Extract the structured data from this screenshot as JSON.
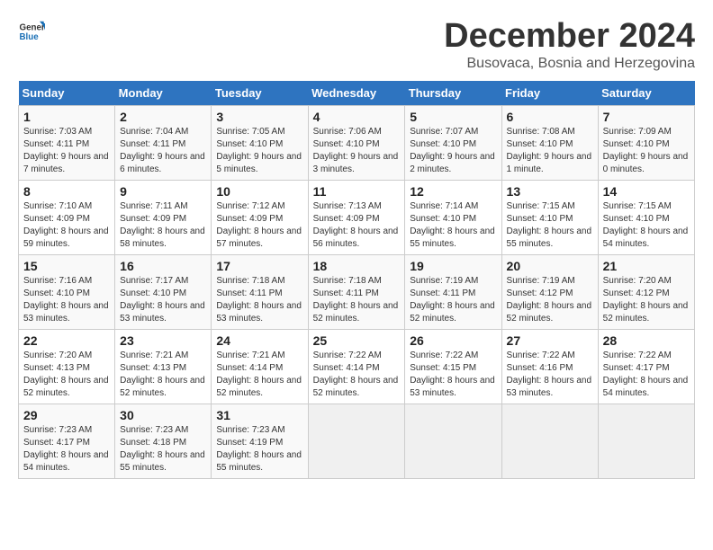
{
  "logo": {
    "text_general": "General",
    "text_blue": "Blue"
  },
  "title": "December 2024",
  "subtitle": "Busovaca, Bosnia and Herzegovina",
  "header": {
    "days": [
      "Sunday",
      "Monday",
      "Tuesday",
      "Wednesday",
      "Thursday",
      "Friday",
      "Saturday"
    ]
  },
  "weeks": [
    [
      {
        "day": "1",
        "sunrise": "Sunrise: 7:03 AM",
        "sunset": "Sunset: 4:11 PM",
        "daylight": "Daylight: 9 hours and 7 minutes."
      },
      {
        "day": "2",
        "sunrise": "Sunrise: 7:04 AM",
        "sunset": "Sunset: 4:11 PM",
        "daylight": "Daylight: 9 hours and 6 minutes."
      },
      {
        "day": "3",
        "sunrise": "Sunrise: 7:05 AM",
        "sunset": "Sunset: 4:10 PM",
        "daylight": "Daylight: 9 hours and 5 minutes."
      },
      {
        "day": "4",
        "sunrise": "Sunrise: 7:06 AM",
        "sunset": "Sunset: 4:10 PM",
        "daylight": "Daylight: 9 hours and 3 minutes."
      },
      {
        "day": "5",
        "sunrise": "Sunrise: 7:07 AM",
        "sunset": "Sunset: 4:10 PM",
        "daylight": "Daylight: 9 hours and 2 minutes."
      },
      {
        "day": "6",
        "sunrise": "Sunrise: 7:08 AM",
        "sunset": "Sunset: 4:10 PM",
        "daylight": "Daylight: 9 hours and 1 minute."
      },
      {
        "day": "7",
        "sunrise": "Sunrise: 7:09 AM",
        "sunset": "Sunset: 4:10 PM",
        "daylight": "Daylight: 9 hours and 0 minutes."
      }
    ],
    [
      {
        "day": "8",
        "sunrise": "Sunrise: 7:10 AM",
        "sunset": "Sunset: 4:09 PM",
        "daylight": "Daylight: 8 hours and 59 minutes."
      },
      {
        "day": "9",
        "sunrise": "Sunrise: 7:11 AM",
        "sunset": "Sunset: 4:09 PM",
        "daylight": "Daylight: 8 hours and 58 minutes."
      },
      {
        "day": "10",
        "sunrise": "Sunrise: 7:12 AM",
        "sunset": "Sunset: 4:09 PM",
        "daylight": "Daylight: 8 hours and 57 minutes."
      },
      {
        "day": "11",
        "sunrise": "Sunrise: 7:13 AM",
        "sunset": "Sunset: 4:09 PM",
        "daylight": "Daylight: 8 hours and 56 minutes."
      },
      {
        "day": "12",
        "sunrise": "Sunrise: 7:14 AM",
        "sunset": "Sunset: 4:10 PM",
        "daylight": "Daylight: 8 hours and 55 minutes."
      },
      {
        "day": "13",
        "sunrise": "Sunrise: 7:15 AM",
        "sunset": "Sunset: 4:10 PM",
        "daylight": "Daylight: 8 hours and 55 minutes."
      },
      {
        "day": "14",
        "sunrise": "Sunrise: 7:15 AM",
        "sunset": "Sunset: 4:10 PM",
        "daylight": "Daylight: 8 hours and 54 minutes."
      }
    ],
    [
      {
        "day": "15",
        "sunrise": "Sunrise: 7:16 AM",
        "sunset": "Sunset: 4:10 PM",
        "daylight": "Daylight: 8 hours and 53 minutes."
      },
      {
        "day": "16",
        "sunrise": "Sunrise: 7:17 AM",
        "sunset": "Sunset: 4:10 PM",
        "daylight": "Daylight: 8 hours and 53 minutes."
      },
      {
        "day": "17",
        "sunrise": "Sunrise: 7:18 AM",
        "sunset": "Sunset: 4:11 PM",
        "daylight": "Daylight: 8 hours and 53 minutes."
      },
      {
        "day": "18",
        "sunrise": "Sunrise: 7:18 AM",
        "sunset": "Sunset: 4:11 PM",
        "daylight": "Daylight: 8 hours and 52 minutes."
      },
      {
        "day": "19",
        "sunrise": "Sunrise: 7:19 AM",
        "sunset": "Sunset: 4:11 PM",
        "daylight": "Daylight: 8 hours and 52 minutes."
      },
      {
        "day": "20",
        "sunrise": "Sunrise: 7:19 AM",
        "sunset": "Sunset: 4:12 PM",
        "daylight": "Daylight: 8 hours and 52 minutes."
      },
      {
        "day": "21",
        "sunrise": "Sunrise: 7:20 AM",
        "sunset": "Sunset: 4:12 PM",
        "daylight": "Daylight: 8 hours and 52 minutes."
      }
    ],
    [
      {
        "day": "22",
        "sunrise": "Sunrise: 7:20 AM",
        "sunset": "Sunset: 4:13 PM",
        "daylight": "Daylight: 8 hours and 52 minutes."
      },
      {
        "day": "23",
        "sunrise": "Sunrise: 7:21 AM",
        "sunset": "Sunset: 4:13 PM",
        "daylight": "Daylight: 8 hours and 52 minutes."
      },
      {
        "day": "24",
        "sunrise": "Sunrise: 7:21 AM",
        "sunset": "Sunset: 4:14 PM",
        "daylight": "Daylight: 8 hours and 52 minutes."
      },
      {
        "day": "25",
        "sunrise": "Sunrise: 7:22 AM",
        "sunset": "Sunset: 4:14 PM",
        "daylight": "Daylight: 8 hours and 52 minutes."
      },
      {
        "day": "26",
        "sunrise": "Sunrise: 7:22 AM",
        "sunset": "Sunset: 4:15 PM",
        "daylight": "Daylight: 8 hours and 53 minutes."
      },
      {
        "day": "27",
        "sunrise": "Sunrise: 7:22 AM",
        "sunset": "Sunset: 4:16 PM",
        "daylight": "Daylight: 8 hours and 53 minutes."
      },
      {
        "day": "28",
        "sunrise": "Sunrise: 7:22 AM",
        "sunset": "Sunset: 4:17 PM",
        "daylight": "Daylight: 8 hours and 54 minutes."
      }
    ],
    [
      {
        "day": "29",
        "sunrise": "Sunrise: 7:23 AM",
        "sunset": "Sunset: 4:17 PM",
        "daylight": "Daylight: 8 hours and 54 minutes."
      },
      {
        "day": "30",
        "sunrise": "Sunrise: 7:23 AM",
        "sunset": "Sunset: 4:18 PM",
        "daylight": "Daylight: 8 hours and 55 minutes."
      },
      {
        "day": "31",
        "sunrise": "Sunrise: 7:23 AM",
        "sunset": "Sunset: 4:19 PM",
        "daylight": "Daylight: 8 hours and 55 minutes."
      },
      null,
      null,
      null,
      null
    ]
  ]
}
